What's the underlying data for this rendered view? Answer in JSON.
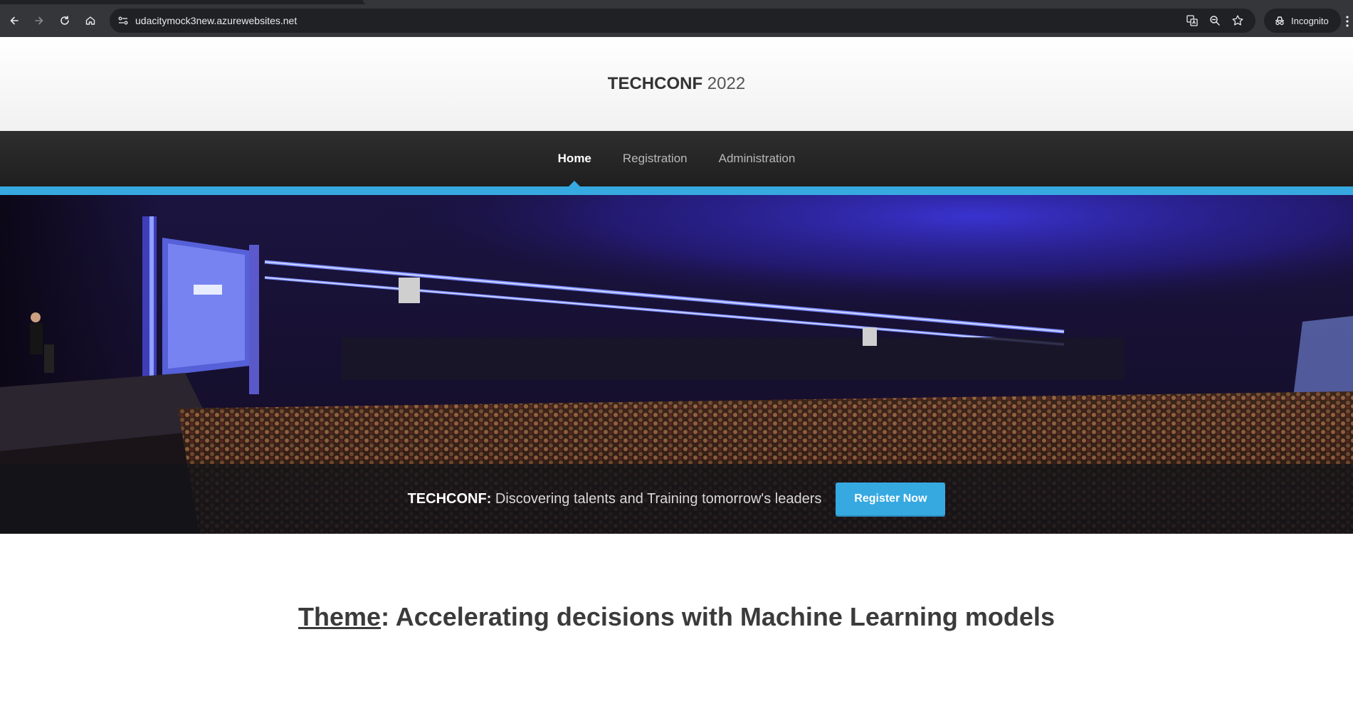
{
  "browser": {
    "url": "udacitymock3new.azurewebsites.net",
    "incognito_label": "Incognito"
  },
  "site": {
    "logo_strong": "TECHCONF",
    "logo_year": "2022"
  },
  "nav": {
    "items": [
      {
        "label": "Home",
        "active": true
      },
      {
        "label": "Registration",
        "active": false
      },
      {
        "label": "Administration",
        "active": false
      }
    ]
  },
  "banner": {
    "brand": "TECHCONF:",
    "tagline": "Discovering talents and Training tomorrow's leaders",
    "cta_label": "Register Now"
  },
  "theme": {
    "label": "Theme",
    "text": ": Accelerating decisions with Machine Learning models"
  },
  "colors": {
    "accent": "#37a9e1",
    "nav_bg": "#262626"
  }
}
